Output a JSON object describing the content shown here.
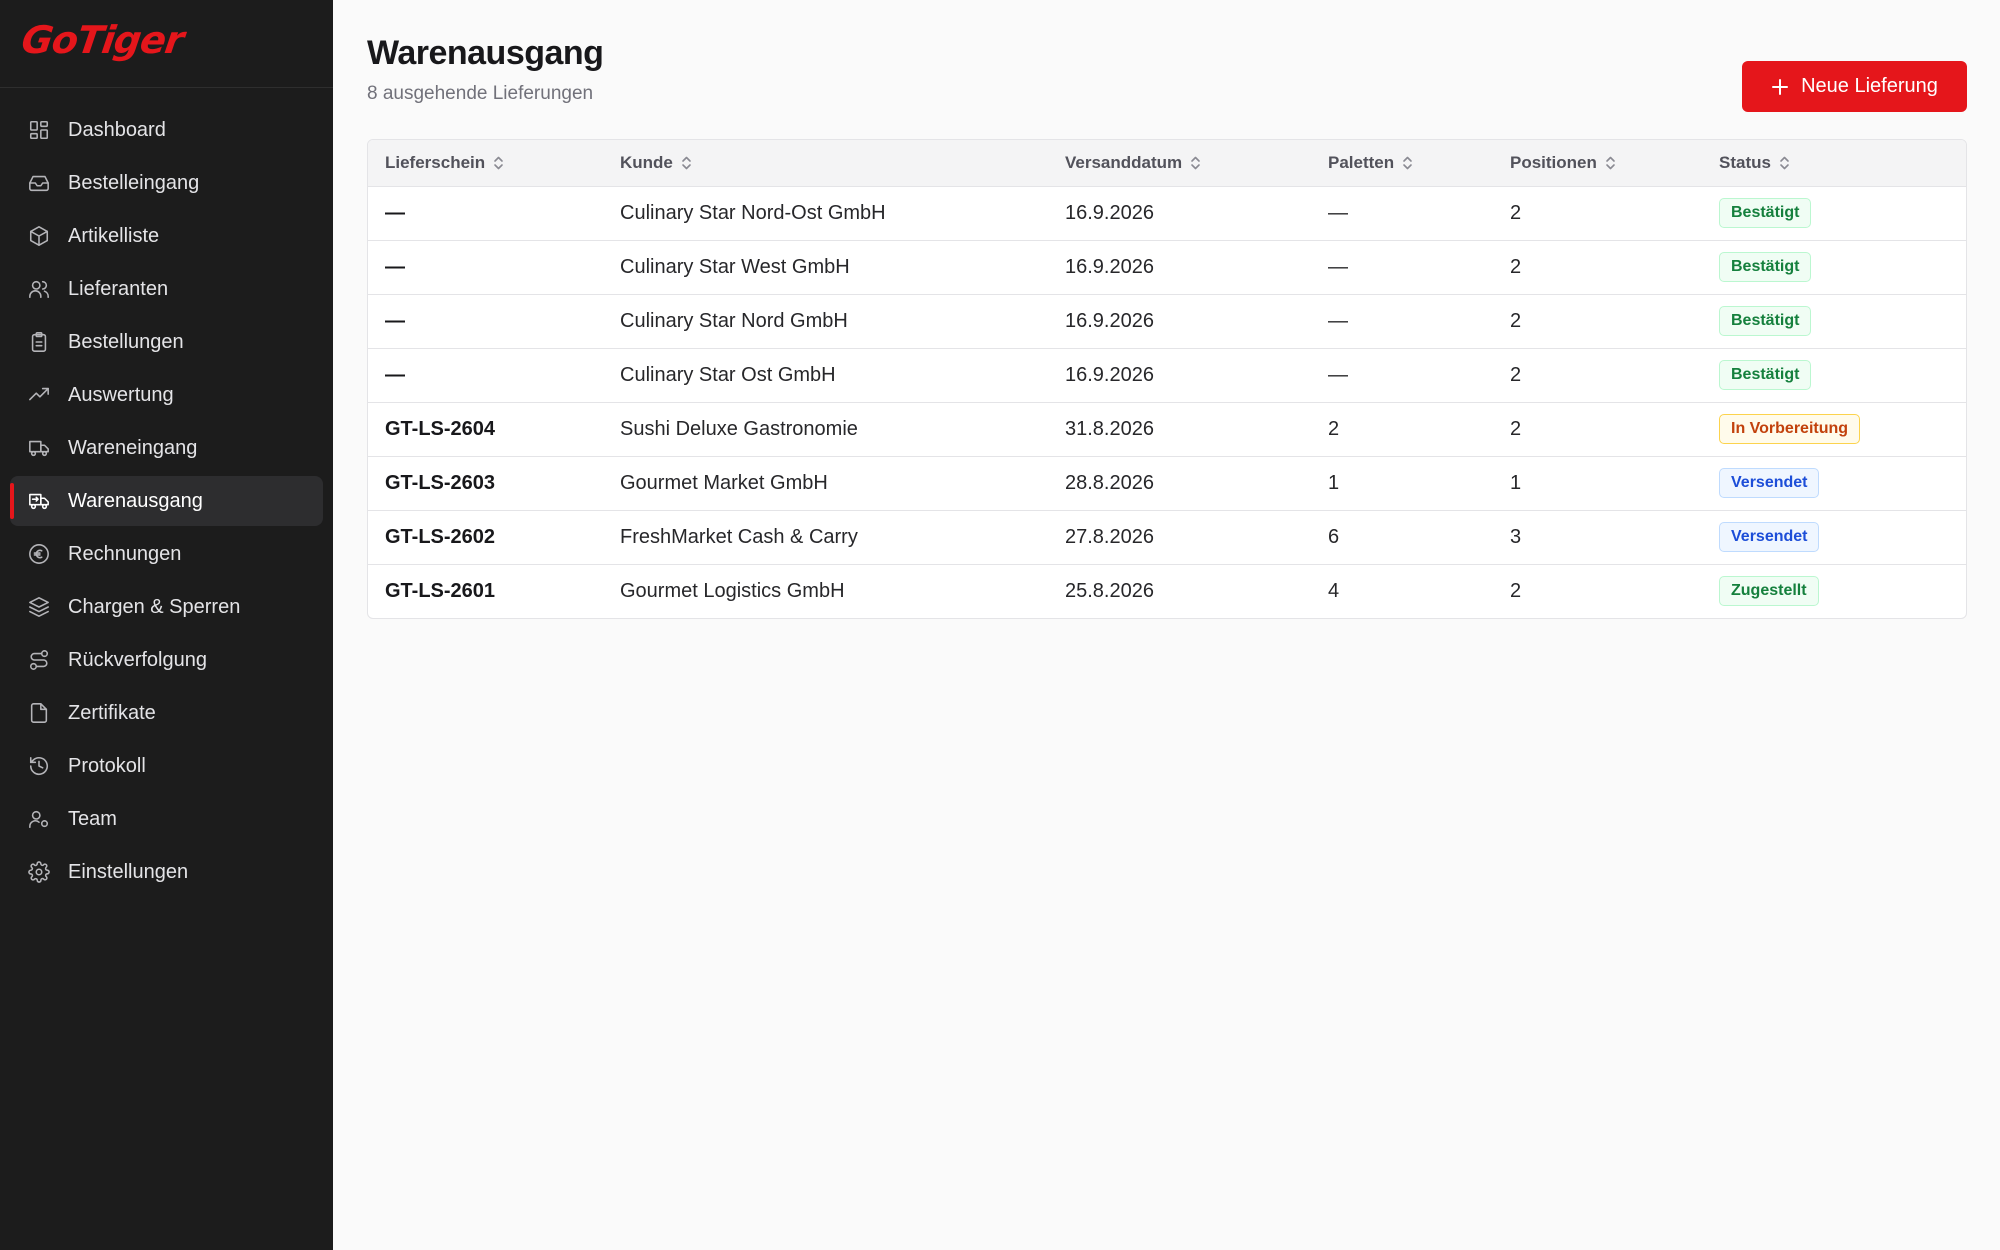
{
  "brand": {
    "logo_text": "GoTiger",
    "accent": "#e5161b"
  },
  "sidebar": {
    "items": [
      {
        "label": "Dashboard",
        "icon": "dashboard-icon",
        "active": false
      },
      {
        "label": "Bestelleingang",
        "icon": "inbox-icon",
        "active": false
      },
      {
        "label": "Artikelliste",
        "icon": "package-icon",
        "active": false
      },
      {
        "label": "Lieferanten",
        "icon": "users-icon",
        "active": false
      },
      {
        "label": "Bestellungen",
        "icon": "clipboard-icon",
        "active": false
      },
      {
        "label": "Auswertung",
        "icon": "trending-up-icon",
        "active": false
      },
      {
        "label": "Wareneingang",
        "icon": "truck-icon",
        "active": false
      },
      {
        "label": "Warenausgang",
        "icon": "truck-outgoing-icon",
        "active": true
      },
      {
        "label": "Rechnungen",
        "icon": "euro-icon",
        "active": false
      },
      {
        "label": "Chargen & Sperren",
        "icon": "layers-icon",
        "active": false
      },
      {
        "label": "Rückverfolgung",
        "icon": "route-icon",
        "active": false
      },
      {
        "label": "Zertifikate",
        "icon": "file-icon",
        "active": false
      },
      {
        "label": "Protokoll",
        "icon": "history-icon",
        "active": false
      },
      {
        "label": "Team",
        "icon": "user-cog-icon",
        "active": false
      },
      {
        "label": "Einstellungen",
        "icon": "gear-icon",
        "active": false
      }
    ]
  },
  "header": {
    "title": "Warenausgang",
    "subtitle": "8 ausgehende Lieferungen",
    "new_button_label": "Neue Lieferung"
  },
  "table": {
    "columns": [
      "Lieferschein",
      "Kunde",
      "Versanddatum",
      "Paletten",
      "Positionen",
      "Status"
    ],
    "rows": [
      {
        "lieferschein": "—",
        "kunde": "Culinary Star Nord-Ost GmbH",
        "datum": "16.9.2026",
        "paletten": "—",
        "positionen": "2",
        "status": "Bestätigt",
        "status_kind": "confirmed"
      },
      {
        "lieferschein": "—",
        "kunde": "Culinary Star West GmbH",
        "datum": "16.9.2026",
        "paletten": "—",
        "positionen": "2",
        "status": "Bestätigt",
        "status_kind": "confirmed"
      },
      {
        "lieferschein": "—",
        "kunde": "Culinary Star Nord GmbH",
        "datum": "16.9.2026",
        "paletten": "—",
        "positionen": "2",
        "status": "Bestätigt",
        "status_kind": "confirmed"
      },
      {
        "lieferschein": "—",
        "kunde": "Culinary Star Ost GmbH",
        "datum": "16.9.2026",
        "paletten": "—",
        "positionen": "2",
        "status": "Bestätigt",
        "status_kind": "confirmed"
      },
      {
        "lieferschein": "GT-LS-2604",
        "kunde": "Sushi Deluxe Gastronomie",
        "datum": "31.8.2026",
        "paletten": "2",
        "positionen": "2",
        "status": "In Vorbereitung",
        "status_kind": "preparing"
      },
      {
        "lieferschein": "GT-LS-2603",
        "kunde": "Gourmet Market GmbH",
        "datum": "28.8.2026",
        "paletten": "1",
        "positionen": "1",
        "status": "Versendet",
        "status_kind": "shipped"
      },
      {
        "lieferschein": "GT-LS-2602",
        "kunde": "FreshMarket Cash & Carry",
        "datum": "27.8.2026",
        "paletten": "6",
        "positionen": "3",
        "status": "Versendet",
        "status_kind": "shipped"
      },
      {
        "lieferschein": "GT-LS-2601",
        "kunde": "Gourmet Logistics GmbH",
        "datum": "25.8.2026",
        "paletten": "4",
        "positionen": "2",
        "status": "Zugestellt",
        "status_kind": "delivered"
      }
    ]
  },
  "status_colors": {
    "confirmed": {
      "text": "#15803d",
      "bg": "#f0fdf4",
      "border": "#bbf7d0"
    },
    "preparing": {
      "text": "#c2410c",
      "bg": "#fffbeb",
      "border": "#fcd34d"
    },
    "shipped": {
      "text": "#1d4ed8",
      "bg": "#eff6ff",
      "border": "#bfdbfe"
    },
    "delivered": {
      "text": "#15803d",
      "bg": "#f0fdf4",
      "border": "#bbf7d0"
    }
  }
}
